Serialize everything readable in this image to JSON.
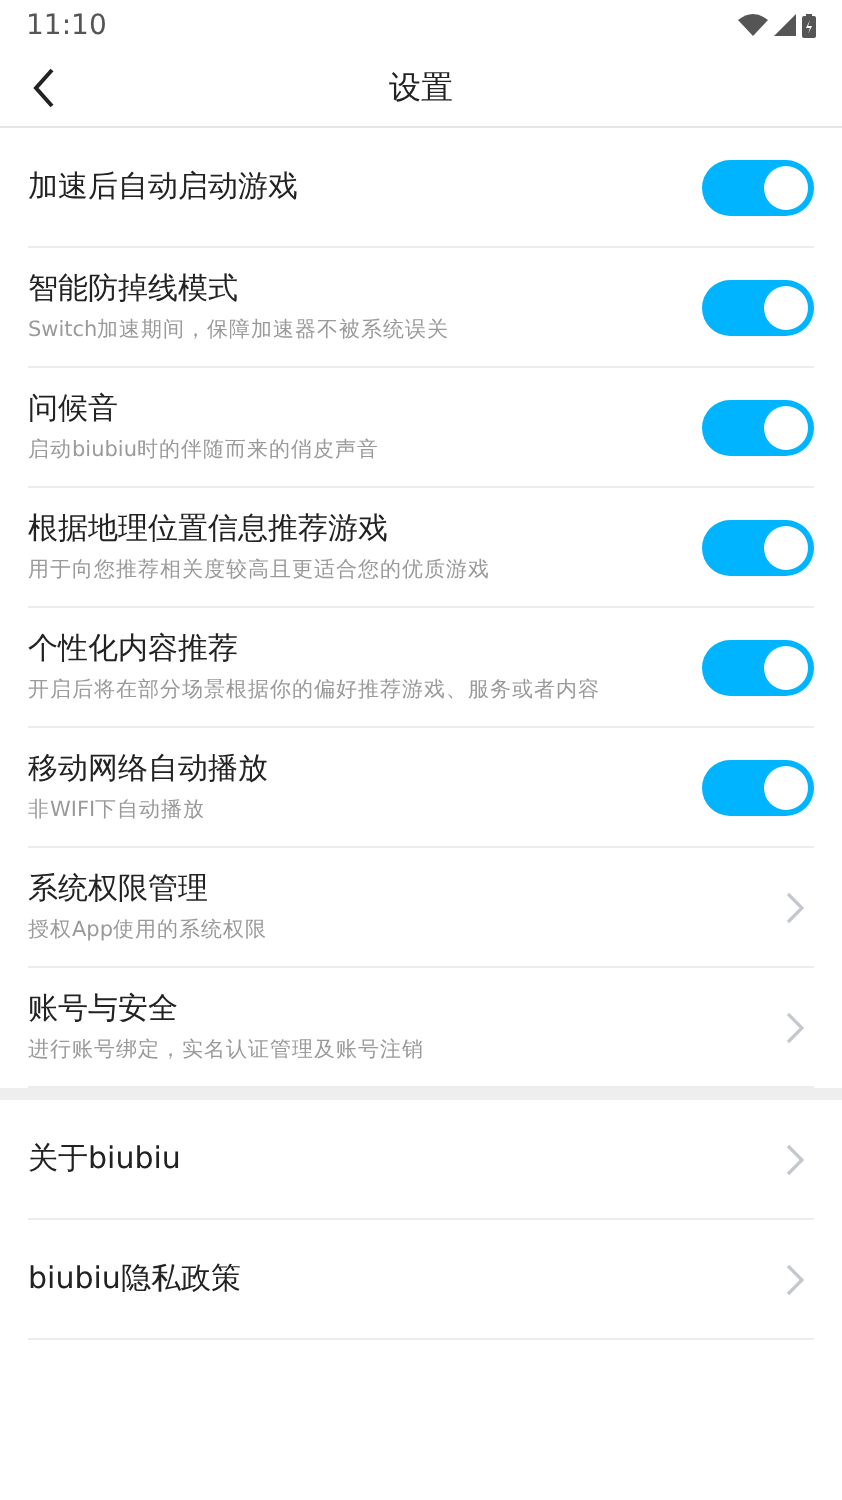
{
  "status_bar": {
    "time": "11:10"
  },
  "header": {
    "title": "设置"
  },
  "sections": [
    {
      "items": [
        {
          "kind": "toggle",
          "title": "加速后自动启动游戏",
          "on": true
        },
        {
          "kind": "toggle",
          "title": "智能防掉线模式",
          "subtitle": "Switch加速期间，保障加速器不被系统误关",
          "on": true
        },
        {
          "kind": "toggle",
          "title": "问候音",
          "subtitle": "启动biubiu时的伴随而来的俏皮声音",
          "on": true
        },
        {
          "kind": "toggle",
          "title": "根据地理位置信息推荐游戏",
          "subtitle": "用于向您推荐相关度较高且更适合您的优质游戏",
          "on": true
        },
        {
          "kind": "toggle",
          "title": "个性化内容推荐",
          "subtitle": "开启后将在部分场景根据你的偏好推荐游戏、服务或者内容",
          "on": true
        },
        {
          "kind": "toggle",
          "title": "移动网络自动播放",
          "subtitle": "非WIFI下自动播放",
          "on": true
        },
        {
          "kind": "link",
          "title": "系统权限管理",
          "subtitle": "授权App使用的系统权限"
        },
        {
          "kind": "link",
          "title": "账号与安全",
          "subtitle": "进行账号绑定，实名认证管理及账号注销"
        }
      ]
    },
    {
      "items": [
        {
          "kind": "link",
          "title": "关于biubiu"
        },
        {
          "kind": "link",
          "title": "biubiu隐私政策"
        }
      ]
    }
  ]
}
